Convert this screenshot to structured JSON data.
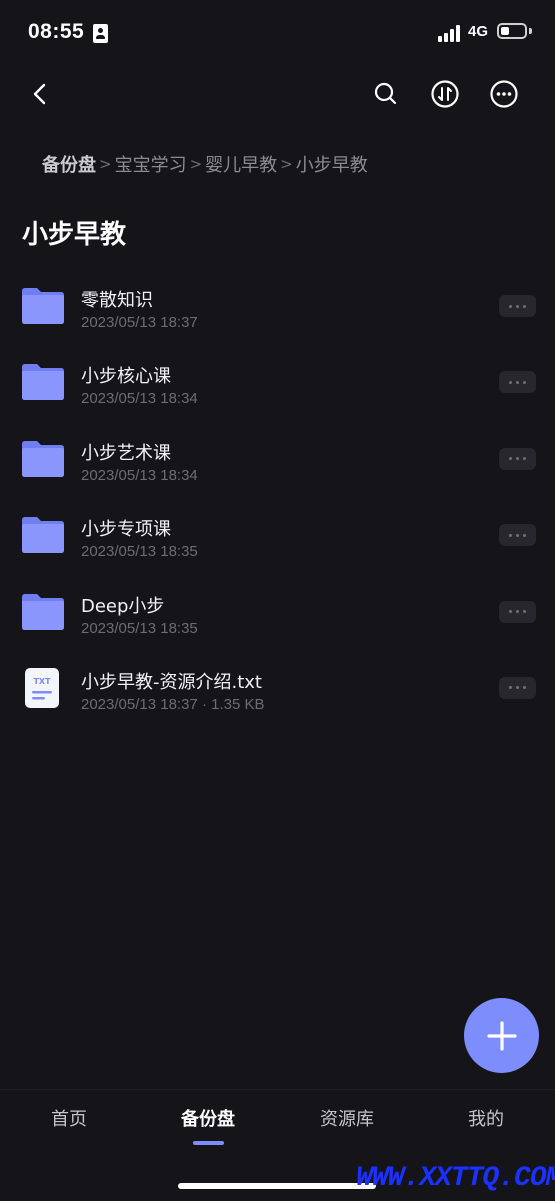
{
  "status_bar": {
    "time": "08:55",
    "network": "4G",
    "signal_bars": 4,
    "battery_level": 0.35
  },
  "header": {
    "back_icon": "chevron-left-icon",
    "search_icon": "search-icon",
    "transfer_icon": "transfer-arrows-icon",
    "more_icon": "more-circle-icon"
  },
  "breadcrumb": [
    "备份盘",
    "宝宝学习",
    "婴儿早教",
    "小步早教"
  ],
  "page_title": "小步早教",
  "files": [
    {
      "name": "零散知识",
      "meta": "2023/05/13 18:37",
      "type": "folder"
    },
    {
      "name": "小步核心课",
      "meta": "2023/05/13 18:34",
      "type": "folder"
    },
    {
      "name": "小步艺术课",
      "meta": "2023/05/13 18:34",
      "type": "folder"
    },
    {
      "name": "小步专项课",
      "meta": "2023/05/13 18:35",
      "type": "folder"
    },
    {
      "name": "Deep小步",
      "meta": "2023/05/13 18:35",
      "type": "folder"
    },
    {
      "name": "小步早教-资源介绍.txt",
      "meta": "2023/05/13 18:37 · 1.35 KB",
      "type": "txt",
      "icon_label": "TXT"
    }
  ],
  "tabs": [
    {
      "label": "首页",
      "active": false
    },
    {
      "label": "备份盘",
      "active": true
    },
    {
      "label": "资源库",
      "active": false
    },
    {
      "label": "我的",
      "active": false
    }
  ],
  "watermark": "WWW.XXTTQ.COM",
  "colors": {
    "background": "#141419",
    "accent": "#7d8dfb",
    "folder": "#8a96fb",
    "secondary_text": "#6c6c73"
  }
}
